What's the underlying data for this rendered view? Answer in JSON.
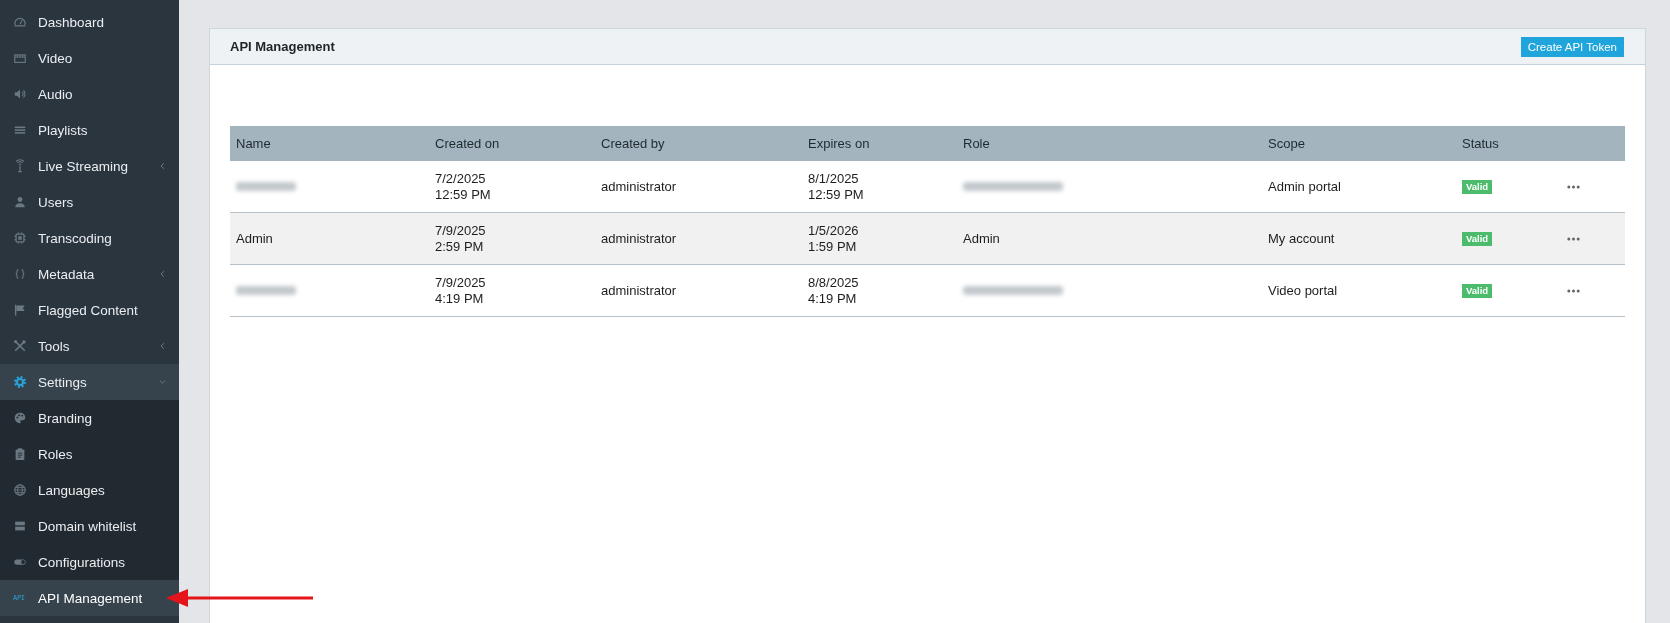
{
  "sidebar": {
    "items": [
      {
        "kind": "link",
        "label": "Dashboard",
        "selected": false
      },
      {
        "kind": "link",
        "label": "Video",
        "selected": false
      },
      {
        "kind": "link",
        "label": "Audio",
        "selected": false
      },
      {
        "kind": "link",
        "label": "Playlists",
        "selected": false
      },
      {
        "kind": "group",
        "label": "Live Streaming",
        "selected": false,
        "expanded": false
      },
      {
        "kind": "link",
        "label": "Users",
        "selected": false
      },
      {
        "kind": "link",
        "label": "Transcoding",
        "selected": false
      },
      {
        "kind": "group",
        "label": "Metadata",
        "selected": false,
        "expanded": false
      },
      {
        "kind": "link",
        "label": "Flagged Content",
        "selected": false
      },
      {
        "kind": "group",
        "label": "Tools",
        "selected": false,
        "expanded": false
      },
      {
        "kind": "group",
        "label": "Settings",
        "selected": false,
        "expanded": true,
        "children": [
          {
            "label": "Branding",
            "selected": false
          },
          {
            "label": "Roles",
            "selected": false
          },
          {
            "label": "Languages",
            "selected": false
          },
          {
            "label": "Domain whitelist",
            "selected": false
          },
          {
            "label": "Configurations",
            "selected": false
          },
          {
            "label": "API Management",
            "selected": true,
            "icon_text": "API"
          }
        ]
      }
    ]
  },
  "panel": {
    "title": "API Management",
    "create_button": "Create API Token"
  },
  "table": {
    "columns": [
      "Name",
      "Created on",
      "Created by",
      "Expires on",
      "Role",
      "Scope",
      "Status"
    ],
    "rows": [
      {
        "name": {
          "blurred": true
        },
        "created_on": "7/2/2025\n12:59 PM",
        "created_by": "administrator",
        "expires_on": "8/1/2025\n12:59 PM",
        "role": {
          "blurred": true
        },
        "scope": "Admin portal",
        "status": {
          "kind": "valid",
          "label": "Valid"
        }
      },
      {
        "name": {
          "blurred": false,
          "text": "Admin"
        },
        "created_on": "7/9/2025\n2:59 PM",
        "created_by": "administrator",
        "expires_on": "1/5/2026\n1:59 PM",
        "role": {
          "blurred": false,
          "text": "Admin"
        },
        "scope": "My account",
        "status": {
          "kind": "valid",
          "label": "Valid"
        }
      },
      {
        "name": {
          "blurred": true
        },
        "created_on": "7/9/2025\n4:19 PM",
        "created_by": "administrator",
        "expires_on": "8/8/2025\n4:19 PM",
        "role": {
          "blurred": true
        },
        "scope": "Video portal",
        "status": {
          "kind": "valid",
          "label": "Valid"
        }
      }
    ]
  }
}
